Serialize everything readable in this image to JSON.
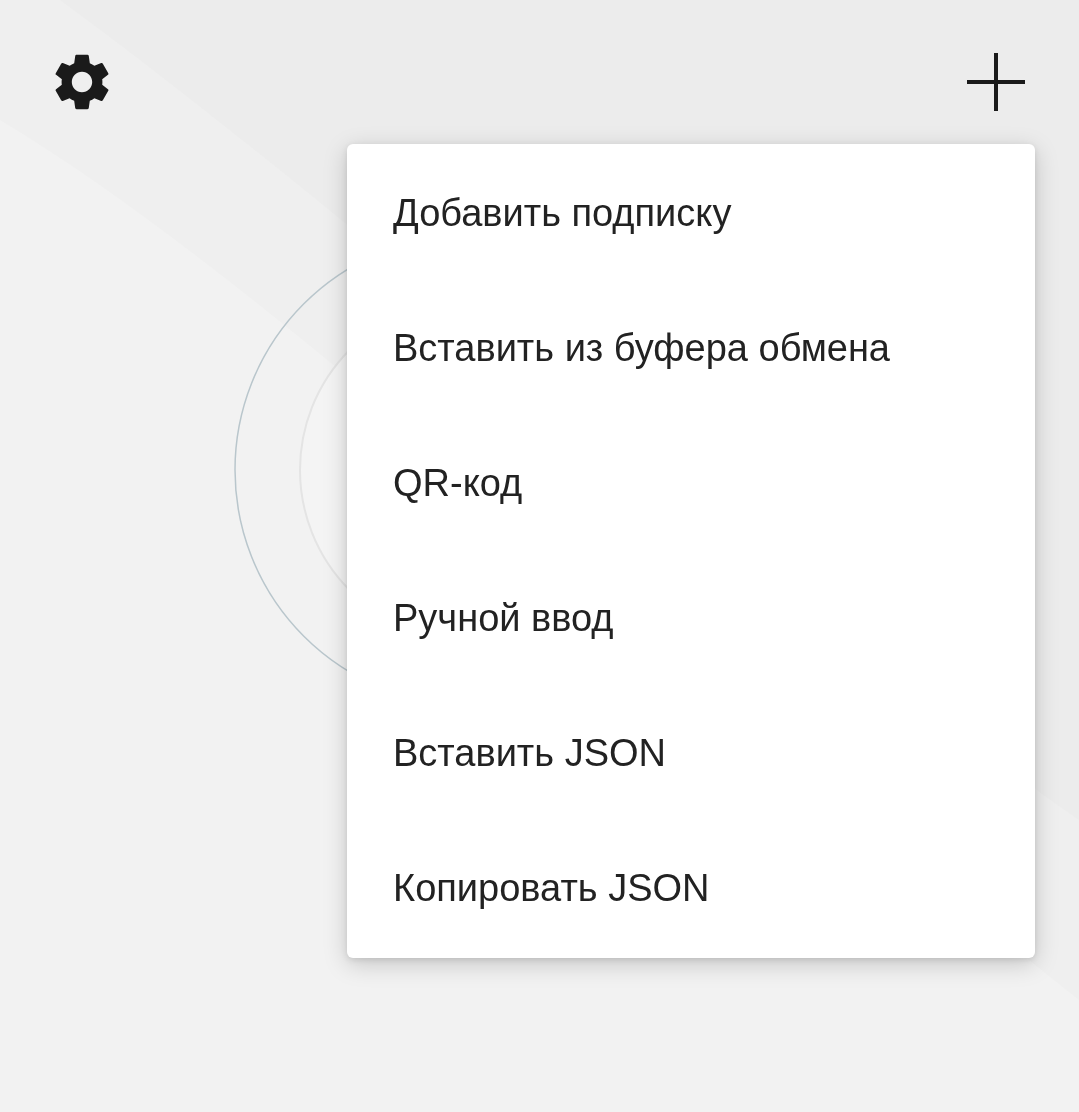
{
  "menu": {
    "items": [
      {
        "label": "Добавить подписку"
      },
      {
        "label": "Вставить из буфера обмена"
      },
      {
        "label": "QR-код"
      },
      {
        "label": "Ручной ввод"
      },
      {
        "label": "Вставить JSON"
      },
      {
        "label": "Копировать JSON"
      }
    ]
  }
}
